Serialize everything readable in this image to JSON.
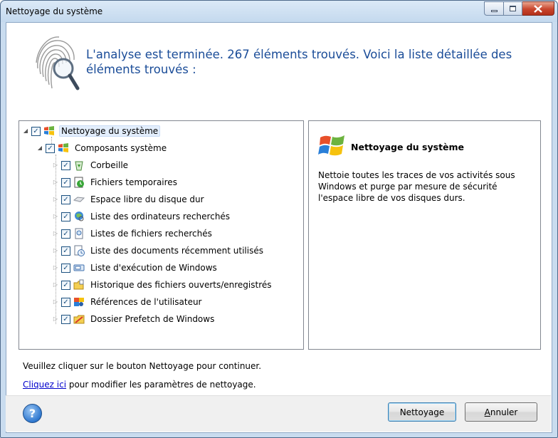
{
  "window": {
    "title": "Nettoyage du système"
  },
  "header": {
    "message": "L'analyse est terminée. 267 éléments trouvés. Voici la liste détaillée des éléments trouvés :"
  },
  "tree": {
    "root": {
      "label": "Nettoyage du système",
      "checked": true,
      "expanded": true
    },
    "group": {
      "label": "Composants système",
      "checked": true,
      "expanded": true
    },
    "items": [
      {
        "label": "Corbeille",
        "checked": true,
        "icon": "recycle-bin-icon"
      },
      {
        "label": "Fichiers temporaires",
        "checked": true,
        "icon": "temp-files-icon"
      },
      {
        "label": "Espace libre du disque dur",
        "checked": true,
        "icon": "hard-disk-icon"
      },
      {
        "label": "Liste des ordinateurs recherchés",
        "checked": true,
        "icon": "computer-search-icon"
      },
      {
        "label": "Listes de fichiers recherchés",
        "checked": true,
        "icon": "file-search-icon"
      },
      {
        "label": "Liste des documents récemment utilisés",
        "checked": true,
        "icon": "recent-documents-icon"
      },
      {
        "label": "Liste d'exécution de Windows",
        "checked": true,
        "icon": "run-dialog-icon"
      },
      {
        "label": "Historique des fichiers ouverts/enregistrés",
        "checked": true,
        "icon": "open-save-history-icon"
      },
      {
        "label": "Références de l'utilisateur",
        "checked": true,
        "icon": "user-references-icon"
      },
      {
        "label": "Dossier Prefetch de Windows",
        "checked": true,
        "icon": "prefetch-folder-icon"
      }
    ]
  },
  "description": {
    "title": "Nettoyage du système",
    "body": "Nettoie toutes les traces de vos activités sous Windows et purge par mesure de sécurité l'espace libre de vos disques durs."
  },
  "notes": {
    "continue": "Veuillez cliquer sur le bouton Nettoyage pour continuer.",
    "link_text": "Cliquez ici",
    "link_suffix": " pour modifier les paramètres de nettoyage."
  },
  "buttons": {
    "help": "?",
    "clean": "Nettoyage",
    "cancel_first": "A",
    "cancel_rest": "nnuler"
  },
  "colors": {
    "header_text": "#1a4c98",
    "link": "#0000cc",
    "frame": "#c9dcef"
  }
}
